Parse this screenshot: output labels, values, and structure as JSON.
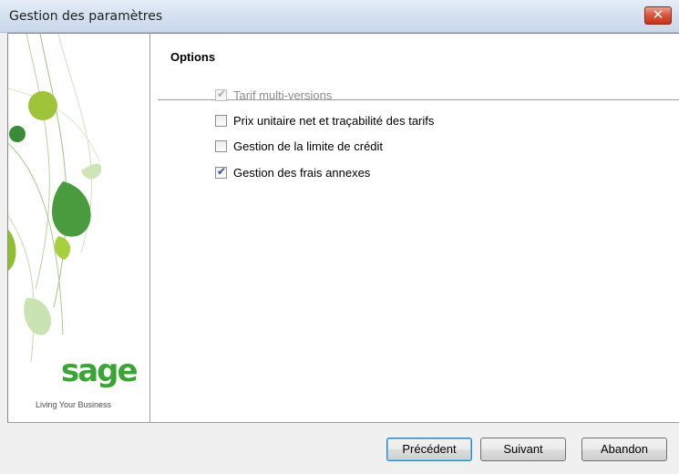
{
  "window": {
    "title": "Gestion des paramètres"
  },
  "page": {
    "heading": "Options"
  },
  "options": [
    {
      "label": "Tarif multi-versions",
      "checked": true,
      "enabled": false
    },
    {
      "label": "Prix unitaire net et traçabilité des tarifs",
      "checked": false,
      "enabled": true
    },
    {
      "label": "Gestion de la limite de crédit",
      "checked": false,
      "enabled": true
    },
    {
      "label": "Gestion des frais annexes",
      "checked": true,
      "enabled": true
    }
  ],
  "branding": {
    "logo": "sage",
    "tagline": "Living Your Business"
  },
  "buttons": {
    "previous": "Précédent",
    "next": "Suivant",
    "cancel": "Abandon"
  },
  "colors": {
    "brand_green": "#3aa535",
    "check_blue": "#2a4e99"
  },
  "icons": {
    "close": "close-icon",
    "check": "check-icon"
  }
}
